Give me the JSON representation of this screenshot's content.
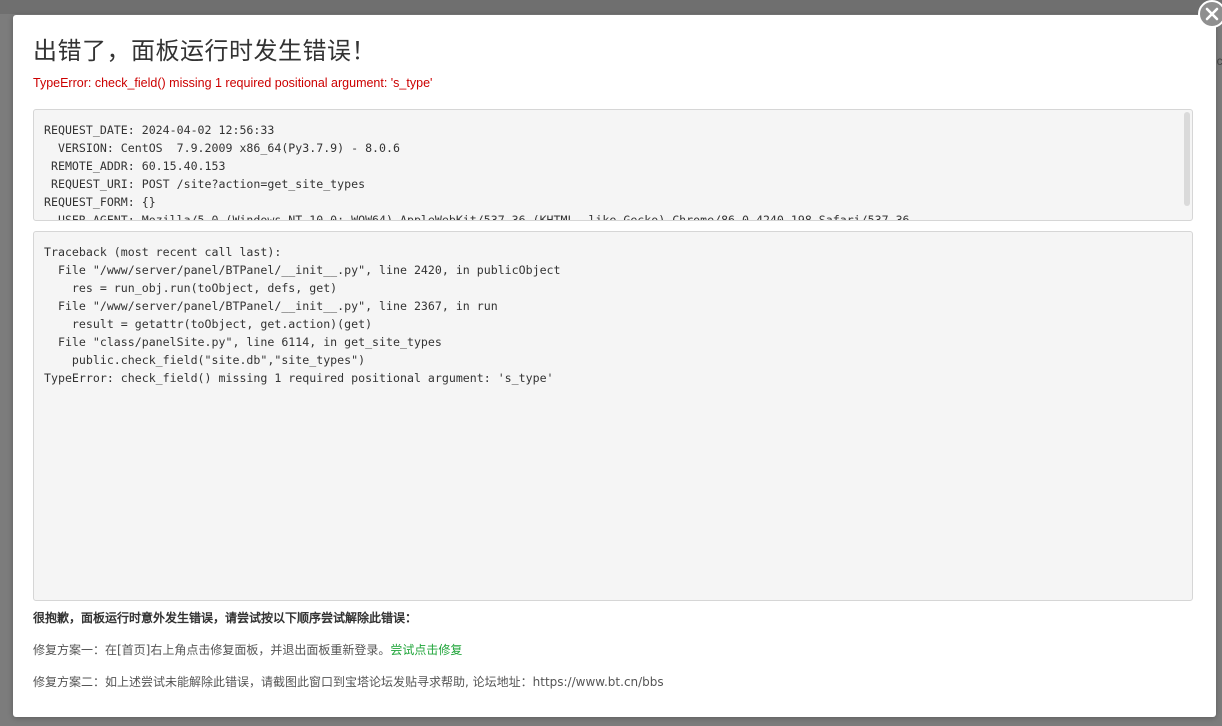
{
  "background": {
    "right_text": "nc"
  },
  "dialog": {
    "title": "出错了，面板运行时发生错误！",
    "error_message": "TypeError: check_field() missing 1 required positional argument: 's_type'",
    "request_info": "REQUEST_DATE: 2024-04-02 12:56:33\n  VERSION: CentOS  7.9.2009 x86_64(Py3.7.9) - 8.0.6\n REMOTE_ADDR: 60.15.40.153\n REQUEST_URI: POST /site?action=get_site_types\nREQUEST_FORM: {}\n  USER_AGENT: Mozilla/5.0 (Windows NT 10.0; WOW64) AppleWebKit/537.36 (KHTML, like Gecko) Chrome/86.0.4240.198 Safari/537.36",
    "traceback": "Traceback (most recent call last):\n  File \"/www/server/panel/BTPanel/__init__.py\", line 2420, in publicObject\n    res = run_obj.run(toObject, defs, get)\n  File \"/www/server/panel/BTPanel/__init__.py\", line 2367, in run\n    result = getattr(toObject, get.action)(get)\n  File \"class/panelSite.py\", line 6114, in get_site_types\n    public.check_field(\"site.db\",\"site_types\")\nTypeError: check_field() missing 1 required positional argument: 's_type'",
    "apology": "很抱歉，面板运行时意外发生错误，请尝试按以下顺序尝试解除此错误：",
    "fix_one_text": "修复方案一：在[首页]右上角点击修复面板，并退出面板重新登录。",
    "fix_one_link": "尝试点击修复",
    "fix_two_text": "修复方案二：如上述尝试未能解除此错误，请截图此窗口到宝塔论坛发贴寻求帮助, 论坛地址：https://www.bt.cn/bbs"
  },
  "colors": {
    "error_red": "#cc0000",
    "link_green": "#20a53a",
    "close_button": "#8f8f8f"
  },
  "icons": {
    "close": "close-icon"
  }
}
